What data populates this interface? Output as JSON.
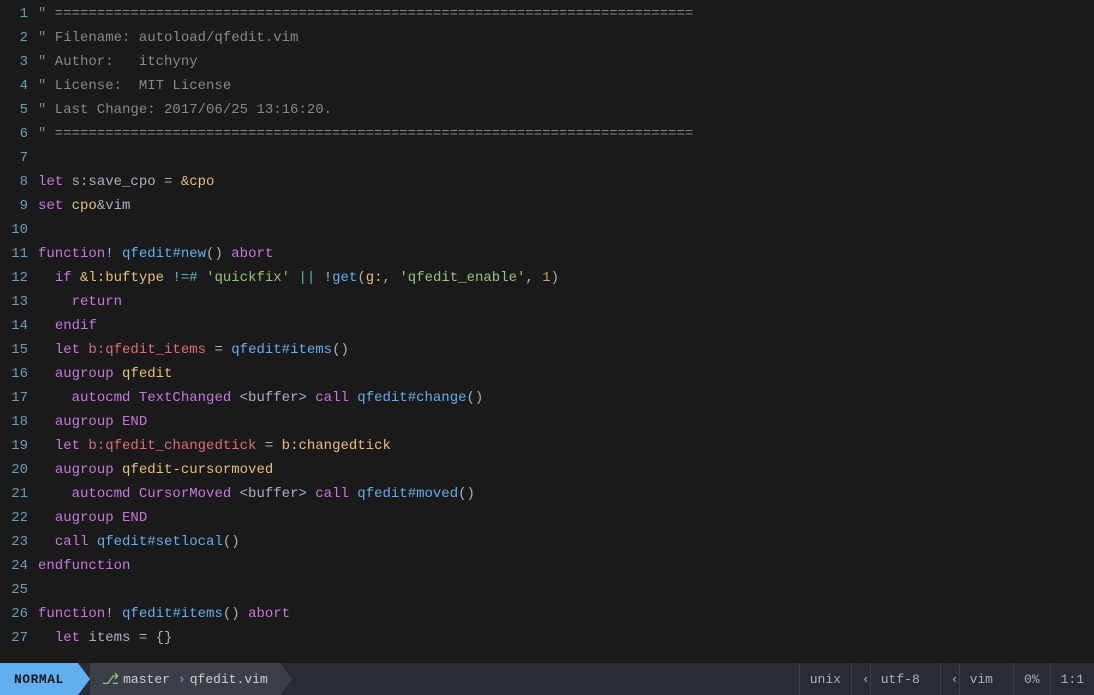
{
  "editor": {
    "title": "qfedit.vim",
    "lines": [
      {
        "num": "1",
        "tokens": [
          {
            "cls": "c-comment",
            "text": "\" ============================================================================"
          }
        ]
      },
      {
        "num": "2",
        "tokens": [
          {
            "cls": "c-comment",
            "text": "\" Filename: autoload/qfedit.vim"
          }
        ]
      },
      {
        "num": "3",
        "tokens": [
          {
            "cls": "c-comment",
            "text": "\" Author:   itchyny"
          }
        ]
      },
      {
        "num": "4",
        "tokens": [
          {
            "cls": "c-comment",
            "text": "\" License:  MIT License"
          }
        ]
      },
      {
        "num": "5",
        "tokens": [
          {
            "cls": "c-comment",
            "text": "\" Last Change: 2017/06/25 13:16:20."
          }
        ]
      },
      {
        "num": "6",
        "tokens": [
          {
            "cls": "c-comment",
            "text": "\" ============================================================================"
          }
        ]
      },
      {
        "num": "7",
        "tokens": []
      },
      {
        "num": "8",
        "tokens": [
          {
            "cls": "c-keyword",
            "text": "let "
          },
          {
            "cls": "c-white",
            "text": "s:save_cpo "
          },
          {
            "cls": "c-white",
            "text": "= "
          },
          {
            "cls": "c-special",
            "text": "&cpo"
          }
        ]
      },
      {
        "num": "9",
        "tokens": [
          {
            "cls": "c-keyword",
            "text": "set "
          },
          {
            "cls": "c-special",
            "text": "cpo"
          },
          {
            "cls": "c-white",
            "text": "&vim"
          }
        ]
      },
      {
        "num": "10",
        "tokens": []
      },
      {
        "num": "11",
        "tokens": [
          {
            "cls": "c-keyword",
            "text": "function"
          },
          {
            "cls": "c-white",
            "text": "! "
          },
          {
            "cls": "c-blue",
            "text": "qfedit#new"
          },
          {
            "cls": "c-white",
            "text": "() "
          },
          {
            "cls": "c-keyword",
            "text": "abort"
          }
        ]
      },
      {
        "num": "12",
        "tokens": [
          {
            "cls": "c-white",
            "text": "  "
          },
          {
            "cls": "c-keyword",
            "text": "if "
          },
          {
            "cls": "c-special",
            "text": "&l:buftype "
          },
          {
            "cls": "c-cyan",
            "text": "!=# "
          },
          {
            "cls": "c-green",
            "text": "'quickfix' "
          },
          {
            "cls": "c-cyan",
            "text": "|| "
          },
          {
            "cls": "c-white",
            "text": "!"
          },
          {
            "cls": "c-blue",
            "text": "get"
          },
          {
            "cls": "c-white",
            "text": "("
          },
          {
            "cls": "c-special",
            "text": "g:"
          },
          {
            "cls": "c-white",
            "text": ", "
          },
          {
            "cls": "c-green",
            "text": "'qfedit_enable'"
          },
          {
            "cls": "c-white",
            "text": ", "
          },
          {
            "cls": "c-orange",
            "text": "1"
          },
          {
            "cls": "c-white",
            "text": ")"
          }
        ]
      },
      {
        "num": "13",
        "tokens": [
          {
            "cls": "c-white",
            "text": "    "
          },
          {
            "cls": "c-keyword",
            "text": "return"
          }
        ]
      },
      {
        "num": "14",
        "tokens": [
          {
            "cls": "c-white",
            "text": "  "
          },
          {
            "cls": "c-keyword",
            "text": "endif"
          }
        ]
      },
      {
        "num": "15",
        "tokens": [
          {
            "cls": "c-white",
            "text": "  "
          },
          {
            "cls": "c-keyword",
            "text": "let "
          },
          {
            "cls": "c-red",
            "text": "b:qfedit_items "
          },
          {
            "cls": "c-white",
            "text": "= "
          },
          {
            "cls": "c-blue",
            "text": "qfedit#items"
          },
          {
            "cls": "c-white",
            "text": "()"
          }
        ]
      },
      {
        "num": "16",
        "tokens": [
          {
            "cls": "c-white",
            "text": "  "
          },
          {
            "cls": "c-keyword",
            "text": "augroup "
          },
          {
            "cls": "c-yellow",
            "text": "qfedit"
          }
        ]
      },
      {
        "num": "17",
        "tokens": [
          {
            "cls": "c-white",
            "text": "    "
          },
          {
            "cls": "c-keyword",
            "text": "autocmd "
          },
          {
            "cls": "c-purple",
            "text": "TextChanged "
          },
          {
            "cls": "c-white",
            "text": "<buffer> "
          },
          {
            "cls": "c-keyword",
            "text": "call "
          },
          {
            "cls": "c-blue",
            "text": "qfedit#change"
          },
          {
            "cls": "c-white",
            "text": "()"
          }
        ]
      },
      {
        "num": "18",
        "tokens": [
          {
            "cls": "c-white",
            "text": "  "
          },
          {
            "cls": "c-keyword",
            "text": "augroup "
          },
          {
            "cls": "c-keyword",
            "text": "END"
          }
        ]
      },
      {
        "num": "19",
        "tokens": [
          {
            "cls": "c-white",
            "text": "  "
          },
          {
            "cls": "c-keyword",
            "text": "let "
          },
          {
            "cls": "c-red",
            "text": "b:qfedit_changedtick "
          },
          {
            "cls": "c-white",
            "text": "= "
          },
          {
            "cls": "c-special",
            "text": "b:changedtick"
          }
        ]
      },
      {
        "num": "20",
        "tokens": [
          {
            "cls": "c-white",
            "text": "  "
          },
          {
            "cls": "c-keyword",
            "text": "augroup "
          },
          {
            "cls": "c-yellow",
            "text": "qfedit-cursormoved"
          }
        ]
      },
      {
        "num": "21",
        "tokens": [
          {
            "cls": "c-white",
            "text": "    "
          },
          {
            "cls": "c-keyword",
            "text": "autocmd "
          },
          {
            "cls": "c-purple",
            "text": "CursorMoved "
          },
          {
            "cls": "c-white",
            "text": "<buffer> "
          },
          {
            "cls": "c-keyword",
            "text": "call "
          },
          {
            "cls": "c-blue",
            "text": "qfedit#moved"
          },
          {
            "cls": "c-white",
            "text": "()"
          }
        ]
      },
      {
        "num": "22",
        "tokens": [
          {
            "cls": "c-white",
            "text": "  "
          },
          {
            "cls": "c-keyword",
            "text": "augroup "
          },
          {
            "cls": "c-keyword",
            "text": "END"
          }
        ]
      },
      {
        "num": "23",
        "tokens": [
          {
            "cls": "c-white",
            "text": "  "
          },
          {
            "cls": "c-keyword",
            "text": "call "
          },
          {
            "cls": "c-blue",
            "text": "qfedit#setlocal"
          },
          {
            "cls": "c-white",
            "text": "()"
          }
        ]
      },
      {
        "num": "24",
        "tokens": [
          {
            "cls": "c-keyword",
            "text": "endfunction"
          }
        ]
      },
      {
        "num": "25",
        "tokens": []
      },
      {
        "num": "26",
        "tokens": [
          {
            "cls": "c-keyword",
            "text": "function"
          },
          {
            "cls": "c-white",
            "text": "! "
          },
          {
            "cls": "c-blue",
            "text": "qfedit#items"
          },
          {
            "cls": "c-white",
            "text": "() "
          },
          {
            "cls": "c-keyword",
            "text": "abort"
          }
        ]
      },
      {
        "num": "27",
        "tokens": [
          {
            "cls": "c-white",
            "text": "  "
          },
          {
            "cls": "c-keyword",
            "text": "let "
          },
          {
            "cls": "c-white",
            "text": "items "
          },
          {
            "cls": "c-white",
            "text": "= "
          },
          {
            "cls": "c-white",
            "text": "{}"
          }
        ]
      }
    ]
  },
  "statusbar": {
    "mode": "NORMAL",
    "branch_icon": "⎇",
    "branch": "master",
    "filename": "qfedit.vim",
    "fileformat": "unix",
    "encoding": "utf-8",
    "filetype": "vim",
    "percent": "0%",
    "position": "1:1"
  }
}
